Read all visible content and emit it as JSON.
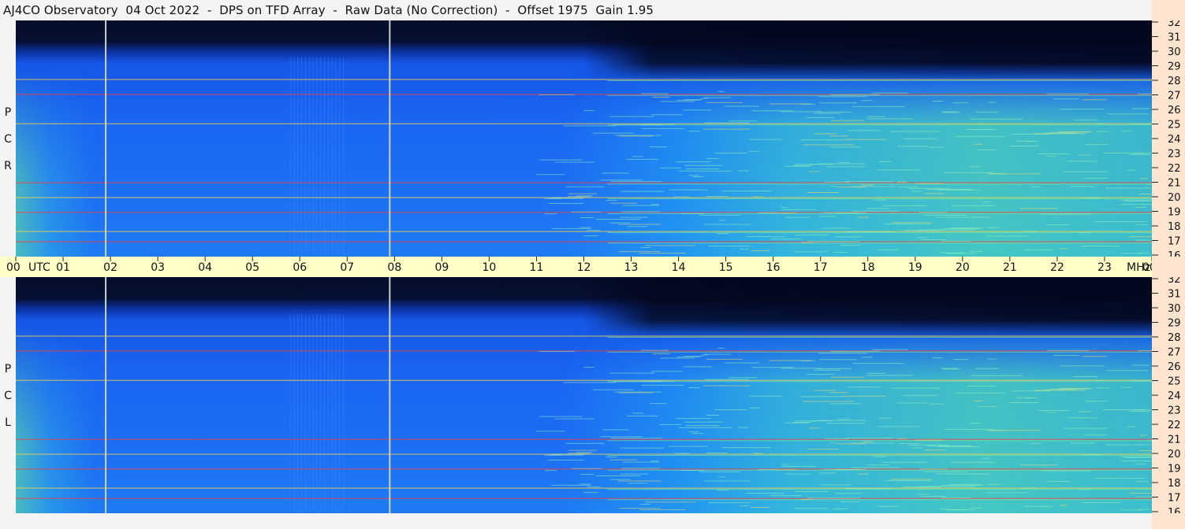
{
  "header": {
    "title": "AJ4CO Observatory  04 Oct 2022  -  DPS on TFD Array  -  Raw Data (No Correction)  -  Offset 1975  Gain 1.95"
  },
  "chart_data": [
    {
      "type": "heatmap",
      "name": "RCP",
      "polarization_label": [
        "R",
        "C",
        "P"
      ],
      "x_unit": "UTC hour",
      "y_unit": "MHz",
      "xlim": [
        0,
        24
      ],
      "ylim": [
        16,
        32
      ],
      "night_cutoff_mhz": 29.5,
      "grid": false,
      "colors": {
        "low": "#06102e",
        "mid": "#1a63f0",
        "high": "#78f0a0",
        "peak": "#ff3a3a"
      },
      "vertical_markers_utc": [
        1.9,
        7.9
      ],
      "horizontal_lines_mhz": [
        17.0,
        17.7,
        19.0,
        20.0,
        21.0,
        25.0,
        27.0,
        28.0
      ],
      "noise_band_utc": [
        5.8,
        7.0
      ]
    },
    {
      "type": "heatmap",
      "name": "LCP",
      "polarization_label": [
        "L",
        "C",
        "P"
      ],
      "x_unit": "UTC hour",
      "y_unit": "MHz",
      "xlim": [
        0,
        24
      ],
      "ylim": [
        16,
        32
      ],
      "night_cutoff_mhz": 29.5,
      "grid": false,
      "colors": {
        "low": "#06102e",
        "mid": "#1a63f0",
        "high": "#78f0a0",
        "peak": "#ff3a3a"
      },
      "vertical_markers_utc": [
        1.9,
        7.9
      ],
      "horizontal_lines_mhz": [
        17.0,
        17.7,
        19.0,
        20.0,
        21.0,
        25.0,
        27.0,
        28.0
      ],
      "noise_band_utc": [
        5.8,
        7.0
      ]
    }
  ],
  "time_axis": {
    "ticks": [
      "00",
      "01",
      "02",
      "03",
      "04",
      "05",
      "06",
      "07",
      "08",
      "09",
      "10",
      "11",
      "12",
      "13",
      "14",
      "15",
      "16",
      "17",
      "18",
      "19",
      "20",
      "21",
      "22",
      "23",
      "00"
    ],
    "utc_label": "UTC",
    "unit_label": "MHz",
    "bg_color": "#ffffc8"
  },
  "freq_axis": {
    "ticks": [
      "32",
      "31",
      "30",
      "29",
      "28",
      "27",
      "26",
      "25",
      "24",
      "23",
      "22",
      "21",
      "20",
      "19",
      "18",
      "17",
      "16"
    ],
    "bg_color": "#ffe5cf"
  }
}
